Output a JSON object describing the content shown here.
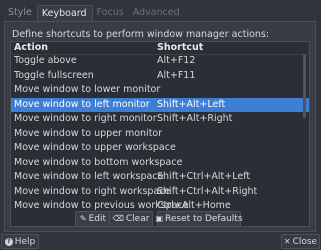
{
  "tabs": [
    {
      "label": "Style"
    },
    {
      "label": "Keyboard"
    },
    {
      "label": "Focus"
    },
    {
      "label": "Advanced"
    }
  ],
  "description": "Define shortcuts to perform window manager actions:",
  "table": {
    "headers": {
      "action": "Action",
      "shortcut": "Shortcut"
    },
    "rows": [
      {
        "action": "Toggle above",
        "shortcut": "Alt+F12"
      },
      {
        "action": "Toggle fullscreen",
        "shortcut": "Alt+F11"
      },
      {
        "action": "Move window to lower monitor",
        "shortcut": ""
      },
      {
        "action": "Move window to left monitor",
        "shortcut": "Shift+Alt+Left"
      },
      {
        "action": "Move window to right monitor",
        "shortcut": "Shift+Alt+Right"
      },
      {
        "action": "Move window to upper monitor",
        "shortcut": ""
      },
      {
        "action": "Move window to upper workspace",
        "shortcut": ""
      },
      {
        "action": "Move window to bottom workspace",
        "shortcut": ""
      },
      {
        "action": "Move window to left workspace",
        "shortcut": "Shift+Ctrl+Alt+Left"
      },
      {
        "action": "Move window to right workspace",
        "shortcut": "Shift+Ctrl+Alt+Right"
      },
      {
        "action": "Move window to previous workspace",
        "shortcut": "Ctrl+Alt+Home"
      }
    ]
  },
  "buttons": {
    "edit": "Edit",
    "clear": "Clear",
    "reset": "Reset to Defaults"
  },
  "footer": {
    "help": "Help",
    "close": "Close"
  }
}
